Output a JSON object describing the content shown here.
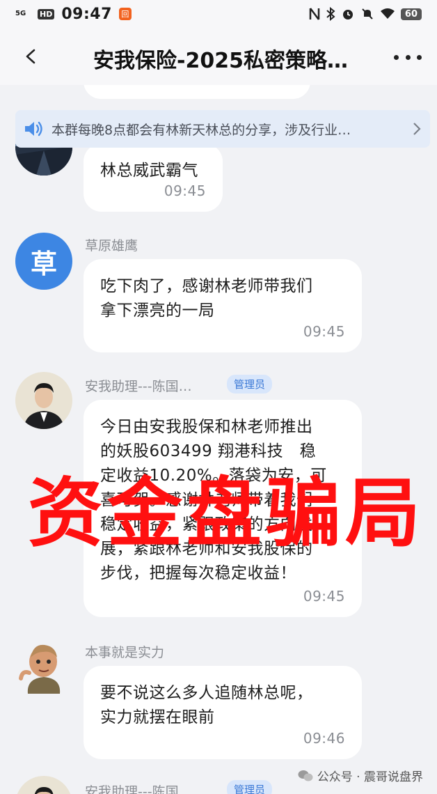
{
  "status_bar": {
    "signal": "5G",
    "hd": "HD",
    "time": "09:47",
    "app_badge": "回",
    "battery": "60"
  },
  "header": {
    "title": "安我保险-2025私密策略…"
  },
  "notice": {
    "text": "本群每晚8点都会有林新天林总的分享，涉及行业…"
  },
  "messages": [
    {
      "text": "林总威武霸气",
      "time": "09:45"
    },
    {
      "sender": "草原雄鹰",
      "avatar_char": "草",
      "text": "吃下肉了，感谢林老师带我们\n拿下漂亮的一局",
      "time": "09:45"
    },
    {
      "sender": "安我助理---陈国…",
      "badge": "管理员",
      "text": "今日由安我股保和林老师推出\n的妖股603499 翔港科技　稳\n定收益10.20%。落袋为安，可\n喜可贺。感谢林老师带着我们\n稳定收益，紧跟政策的方向发\n展，紧跟林老师和安我股保的\n步伐，把握每次稳定收益！",
      "time": "09:45"
    },
    {
      "sender": "本事就是实力",
      "text": "要不说这么多人追随林总呢，\n实力就摆在眼前",
      "time": "09:46"
    },
    {
      "sender": "安我助理---陈国…",
      "badge": "管理员"
    }
  ],
  "overlay": {
    "text": "资金盘骗局"
  },
  "watermark": {
    "text": "公众号 · 震哥说盘界"
  },
  "colors": {
    "bubble": "#ffffff",
    "background": "#f1f2f5",
    "avatar_blue": "#3d86e3",
    "overlay_red": "#ff1010",
    "admin_badge_bg": "#d8e6fb"
  }
}
